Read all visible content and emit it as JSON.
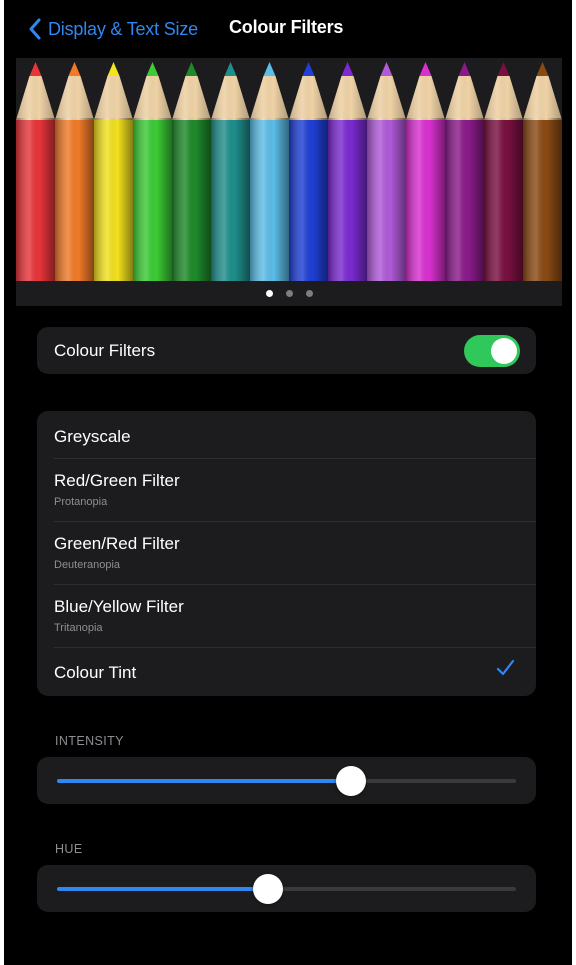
{
  "nav": {
    "back_label": "Display & Text Size",
    "title": "Colour Filters"
  },
  "preview": {
    "pencil_colors": [
      "#e8353a",
      "#f07a28",
      "#f3e21e",
      "#3ccc35",
      "#1e8a2a",
      "#1f8f8c",
      "#5cbde8",
      "#1f3fd6",
      "#7a2ad0",
      "#b05ad8",
      "#d930d0",
      "#8a1a8a",
      "#7a1040",
      "#8a4a14"
    ],
    "page_count": 3,
    "active_page": 1
  },
  "toggle": {
    "label": "Colour Filters",
    "on": true,
    "on_color": "#30c85a"
  },
  "filters": {
    "items": [
      {
        "title": "Greyscale",
        "subtitle": ""
      },
      {
        "title": "Red/Green Filter",
        "subtitle": "Protanopia"
      },
      {
        "title": "Green/Red Filter",
        "subtitle": "Deuteranopia"
      },
      {
        "title": "Blue/Yellow Filter",
        "subtitle": "Tritanopia"
      },
      {
        "title": "Colour Tint",
        "subtitle": ""
      }
    ],
    "selected": "Colour Tint"
  },
  "intensity": {
    "label": "INTENSITY",
    "value": 0.64
  },
  "hue": {
    "label": "HUE",
    "value": 0.46
  },
  "accent_color": "#2f87f0"
}
